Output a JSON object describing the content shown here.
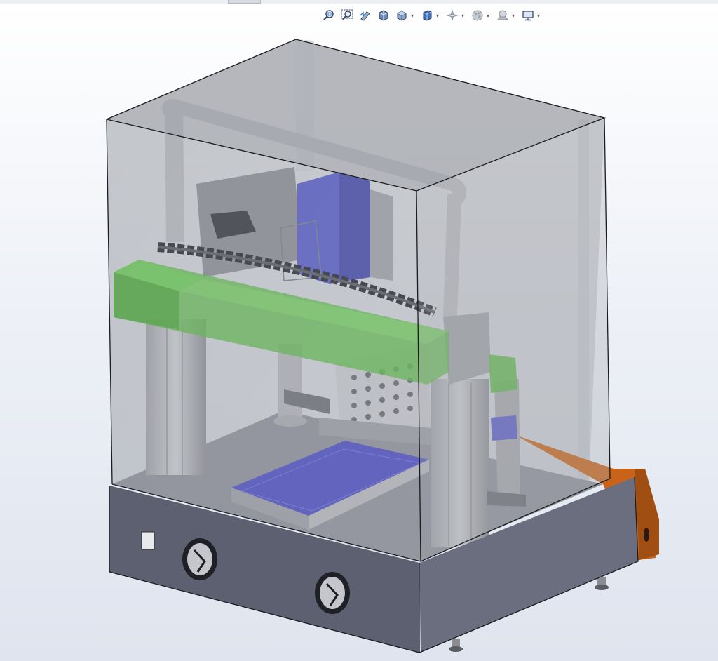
{
  "app": {
    "type": "cad-graphics-area"
  },
  "heads_up_toolbar": {
    "buttons": [
      {
        "id": "zoom-to-fit",
        "icon": "zoom-to-fit-icon",
        "has_dropdown": false
      },
      {
        "id": "zoom-to-area",
        "icon": "zoom-to-area-icon",
        "has_dropdown": false
      },
      {
        "id": "previous-view",
        "icon": "previous-view-icon",
        "has_dropdown": false
      },
      {
        "id": "section-view",
        "icon": "section-view-icon",
        "has_dropdown": false
      },
      {
        "id": "view-orientation",
        "icon": "view-orientation-icon",
        "has_dropdown": true
      },
      {
        "id": "display-style",
        "icon": "display-style-icon",
        "has_dropdown": true
      },
      {
        "id": "hide-show-items",
        "icon": "hide-show-items-icon",
        "has_dropdown": true
      },
      {
        "id": "edit-appearance",
        "icon": "edit-appearance-icon",
        "has_dropdown": true
      },
      {
        "id": "apply-scene",
        "icon": "apply-scene-icon",
        "has_dropdown": true
      },
      {
        "id": "view-settings",
        "icon": "monitor-icon",
        "has_dropdown": true
      }
    ],
    "caret_glyph": "▾"
  },
  "model": {
    "name_visible": false,
    "colors": {
      "enclosure_glass": "#8c9096",
      "base_panel": "#5c6070",
      "gantry_beam": "#5cb848",
      "motor_block": "#5b5fc8",
      "bed": "#5050c0",
      "side_panel": "#c8641a",
      "frame_metal": "#a8aab0"
    }
  }
}
